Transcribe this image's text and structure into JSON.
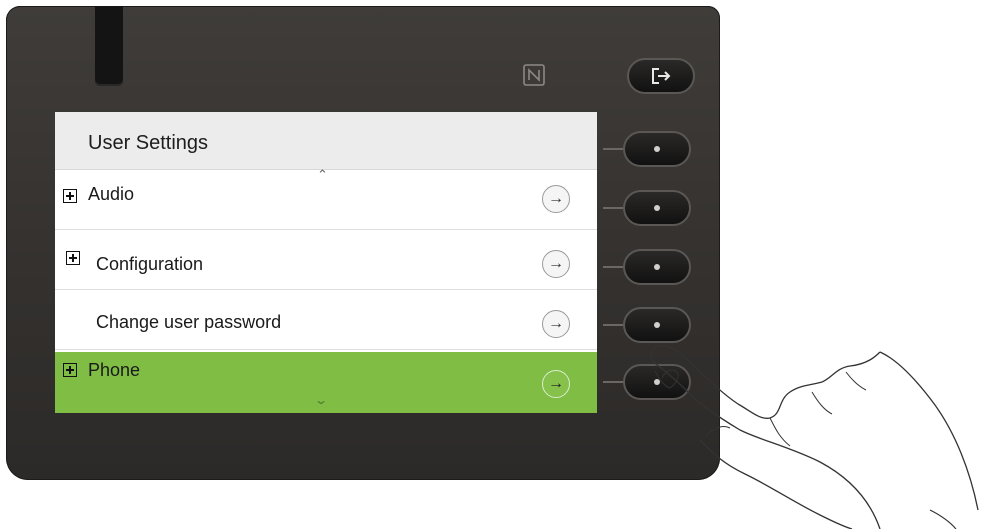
{
  "device": {
    "nfc_symbol": "N",
    "logout_icon": "logout-icon"
  },
  "screen": {
    "title": "User Settings",
    "scroll_up": "⌃",
    "scroll_down": "⌄",
    "items": [
      {
        "label": "Audio",
        "expandable": true,
        "selected": false
      },
      {
        "label": "Configuration",
        "expandable": true,
        "selected": false
      },
      {
        "label": "Change user password",
        "expandable": false,
        "selected": false
      },
      {
        "label": "Phone",
        "expandable": true,
        "selected": true
      }
    ],
    "navigate_arrow": "→"
  },
  "colors": {
    "selected_row": "#7fbd45",
    "device_body": "#3a3735",
    "header_bg": "#ececec"
  }
}
